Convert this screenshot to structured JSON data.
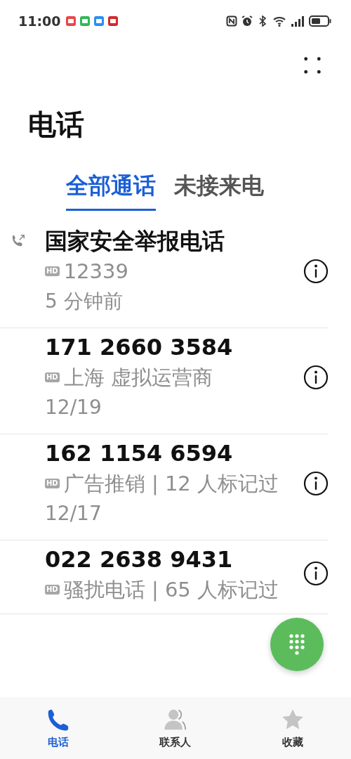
{
  "status_bar": {
    "time": "11:00",
    "notifications": [
      {
        "color": "#e84848"
      },
      {
        "color": "#2fb85a"
      },
      {
        "color": "#2a8ff0"
      },
      {
        "color": "#d42a2a"
      }
    ]
  },
  "title": "电话",
  "tabs": [
    {
      "label": "全部通话",
      "selected": true
    },
    {
      "label": "未接来电",
      "selected": false
    }
  ],
  "calls": [
    {
      "name": "国家安全举报电话",
      "outgoing": true,
      "badge": "HD",
      "detail": "12339",
      "date": "5 分钟前"
    },
    {
      "name": "171 2660 3584",
      "outgoing": false,
      "badge": "HD",
      "detail": "上海 虚拟运营商",
      "date": "12/19"
    },
    {
      "name": "162 1154 6594",
      "outgoing": false,
      "badge": "HD",
      "detail": "广告推销 | 12 人标记过",
      "date": "12/17"
    },
    {
      "name": "022 2638 9431",
      "outgoing": false,
      "badge": "HD",
      "detail": "骚扰电话 | 65 人标记过"
    }
  ],
  "bottom_nav": [
    {
      "label": "电话",
      "kind": "phone",
      "selected": true
    },
    {
      "label": "联系人",
      "kind": "contacts",
      "selected": false
    },
    {
      "label": "收藏",
      "kind": "star",
      "selected": false
    }
  ]
}
